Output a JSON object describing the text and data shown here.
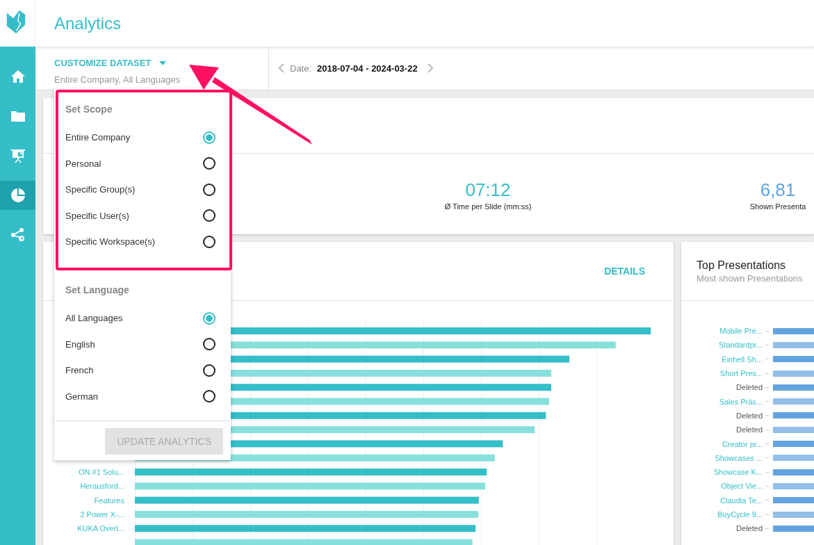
{
  "app": {
    "title": "Analytics"
  },
  "sidebar": {
    "items": [
      {
        "kind": "home",
        "selected": false
      },
      {
        "kind": "folder",
        "selected": false
      },
      {
        "kind": "presentation",
        "selected": false
      },
      {
        "kind": "chart",
        "selected": true
      },
      {
        "kind": "share",
        "selected": false
      }
    ]
  },
  "dataset": {
    "label": "CUSTOMIZE DATASET",
    "summary": "Entire Company, All Languages"
  },
  "date": {
    "label": "Date:",
    "range": "2018-07-04 - 2024-03-22"
  },
  "stats": [
    {
      "value": "07:12",
      "label": "Ø Time per Slide (mm:ss)",
      "color": "#35bec8"
    },
    {
      "value": "6,81",
      "label": "Shown Presenta",
      "color": "#5da3e0"
    }
  ],
  "dropdown": {
    "scope": {
      "title": "Set Scope",
      "options": [
        {
          "label": "Entire Company",
          "selected": true
        },
        {
          "label": "Personal",
          "selected": false
        },
        {
          "label": "Specific Group(s)",
          "selected": false
        },
        {
          "label": "Specific User(s)",
          "selected": false
        },
        {
          "label": "Specific Workspace(s)",
          "selected": false
        }
      ]
    },
    "language": {
      "title": "Set Language",
      "options": [
        {
          "label": "All Languages",
          "selected": true
        },
        {
          "label": "English",
          "selected": false
        },
        {
          "label": "French",
          "selected": false
        },
        {
          "label": "German",
          "selected": false
        }
      ]
    },
    "button": {
      "label": "UPDATE ANALYTICS",
      "disabled": true
    }
  },
  "chart_card": {
    "action": "DETAILS",
    "labels": [
      "ON #1 Solu...",
      "Herausford...",
      "Features",
      "2 Power X-...",
      "KUKA Overl..."
    ]
  },
  "top_card": {
    "title": "Top Presentations",
    "subtitle": "Most shown Presentations",
    "rows": [
      {
        "label": "Mobile Pre...",
        "kind": "presentation"
      },
      {
        "label": "Standardpr...",
        "kind": "presentation"
      },
      {
        "label": "Einhell Sh...",
        "kind": "presentation"
      },
      {
        "label": "Short Pres...",
        "kind": "presentation"
      },
      {
        "label": "Deleted",
        "kind": "deleted"
      },
      {
        "label": "Sales Präs...",
        "kind": "presentation"
      },
      {
        "label": "Deleted",
        "kind": "deleted"
      },
      {
        "label": "Deleted",
        "kind": "deleted"
      },
      {
        "label": "Creator pr...",
        "kind": "presentation"
      },
      {
        "label": "Showcases ...",
        "kind": "presentation"
      },
      {
        "label": "Showcase K...",
        "kind": "presentation"
      },
      {
        "label": "Object Vie...",
        "kind": "presentation"
      },
      {
        "label": "Claudia Te...",
        "kind": "presentation"
      },
      {
        "label": "BuyCycle 9...",
        "kind": "presentation"
      },
      {
        "label": "Deleted",
        "kind": "deleted"
      }
    ]
  }
}
